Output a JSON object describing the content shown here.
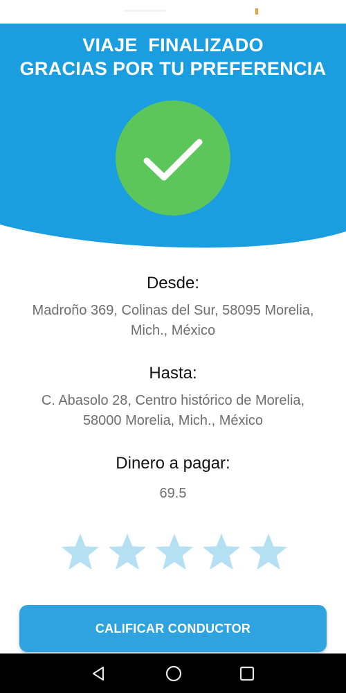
{
  "header": {
    "title_line1": "VIAJE  FINALIZADO",
    "title_line2": "GRACIAS POR TU PREFERENCIA",
    "color": "#1b9ee0",
    "icon": "checkmark-icon",
    "icon_color": "#5dc65a"
  },
  "trip": {
    "from_label": "Desde:",
    "from_line1": "Madroño 369, Colinas del Sur, 58095 Morelia,",
    "from_line2": "Mich., México",
    "to_label": "Hasta:",
    "to_line1": "C. Abasolo 28, Centro histórico de Morelia,",
    "to_line2": "58000 Morelia, Mich., México",
    "fare_label": "Dinero a pagar:",
    "fare_value": "69.5"
  },
  "rating": {
    "max": 5,
    "value": 0,
    "star_color": "#b5e0f4"
  },
  "actions": {
    "rate_button_label": "CALIFICAR CONDUCTOR",
    "button_color": "#2ea3e0"
  },
  "nav": {
    "back_icon": "back-triangle-icon",
    "home_icon": "home-circle-icon",
    "recent_icon": "recent-apps-square-icon"
  }
}
